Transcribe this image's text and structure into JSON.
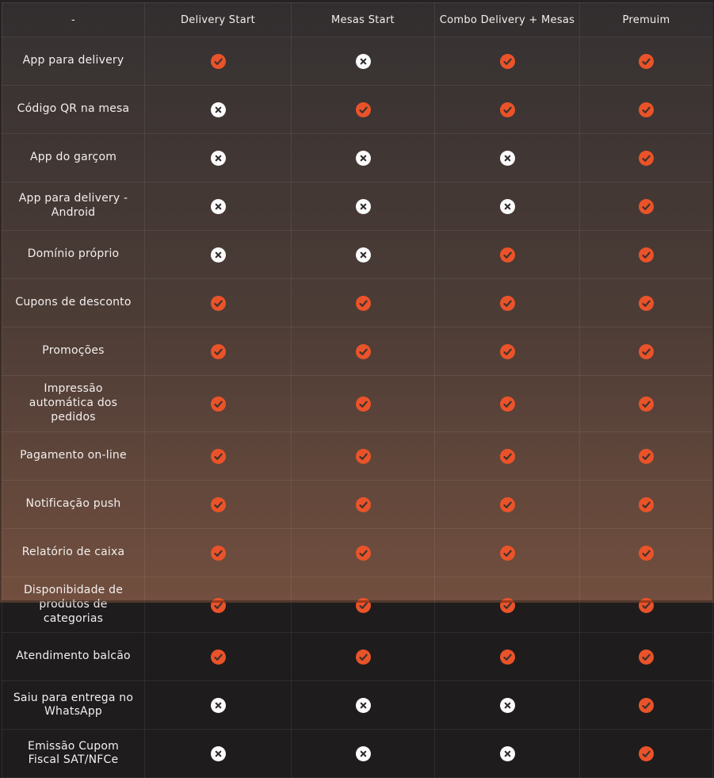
{
  "table": {
    "columns": [
      {
        "label": "-"
      },
      {
        "label": "Delivery Start"
      },
      {
        "label": "Mesas Start"
      },
      {
        "label": "Combo Delivery + Mesas"
      },
      {
        "label": "Premuim"
      }
    ],
    "plans_order": [
      "Delivery Start",
      "Mesas Start",
      "Combo Delivery + Mesas",
      "Premuim"
    ],
    "rows": [
      {
        "feature": "App para delivery",
        "values": [
          true,
          false,
          true,
          true
        ]
      },
      {
        "feature": "Código QR na mesa",
        "values": [
          false,
          true,
          true,
          true
        ]
      },
      {
        "feature": "App do garçom",
        "values": [
          false,
          false,
          false,
          true
        ]
      },
      {
        "feature": "App para delivery - Android",
        "values": [
          false,
          false,
          false,
          true
        ]
      },
      {
        "feature": "Domínio próprio",
        "values": [
          false,
          false,
          true,
          true
        ]
      },
      {
        "feature": "Cupons de desconto",
        "values": [
          true,
          true,
          true,
          true
        ]
      },
      {
        "feature": "Promoções",
        "values": [
          true,
          true,
          true,
          true
        ]
      },
      {
        "feature": "Impressão automática dos pedidos",
        "values": [
          true,
          true,
          true,
          true
        ]
      },
      {
        "feature": "Pagamento on-line",
        "values": [
          true,
          true,
          true,
          true
        ]
      },
      {
        "feature": "Notificação push",
        "values": [
          true,
          true,
          true,
          true
        ]
      },
      {
        "feature": "Relatório de caixa",
        "values": [
          true,
          true,
          true,
          true
        ]
      },
      {
        "feature": "Disponibidade de produtos de categorias",
        "values": [
          true,
          true,
          true,
          true
        ]
      },
      {
        "feature": "Atendimento balcão",
        "values": [
          true,
          true,
          true,
          true
        ]
      },
      {
        "feature": "Saiu para entrega no WhatsApp",
        "values": [
          false,
          false,
          false,
          true
        ]
      },
      {
        "feature": "Emissão Cupom Fiscal SAT/NFCe",
        "values": [
          false,
          false,
          false,
          true
        ]
      }
    ]
  },
  "icons": {
    "included": "check-circle-icon",
    "excluded": "x-circle-icon"
  },
  "colors": {
    "check_circle": "#ea5329",
    "check_mark": "#41332e",
    "x_circle": "#fbfbfb",
    "x_mark": "#322c2d",
    "text": "#f3efee",
    "bg_top": "#353132",
    "bg_mid": "#4c3c36",
    "bg_bottom": "#724f3f"
  }
}
